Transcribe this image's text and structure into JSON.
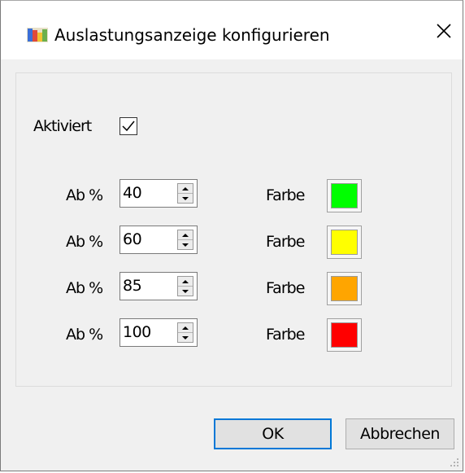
{
  "window": {
    "title": "Auslastungsanzeige konfigurieren",
    "icon": "app-chart-icon",
    "close_icon": "close-icon"
  },
  "activated": {
    "label": "Aktiviert",
    "checked": true
  },
  "thresholds": [
    {
      "label": "Ab %",
      "value": "40",
      "color_label": "Farbe",
      "color": "#00ff00"
    },
    {
      "label": "Ab %",
      "value": "60",
      "color_label": "Farbe",
      "color": "#ffff00"
    },
    {
      "label": "Ab %",
      "value": "85",
      "color_label": "Farbe",
      "color": "#ffa500"
    },
    {
      "label": "Ab %",
      "value": "100",
      "color_label": "Farbe",
      "color": "#ff0000"
    }
  ],
  "buttons": {
    "ok": "OK",
    "cancel": "Abbrechen"
  },
  "colors": {
    "accent": "#0078d7",
    "dialog_bg": "#f0f0f0"
  }
}
